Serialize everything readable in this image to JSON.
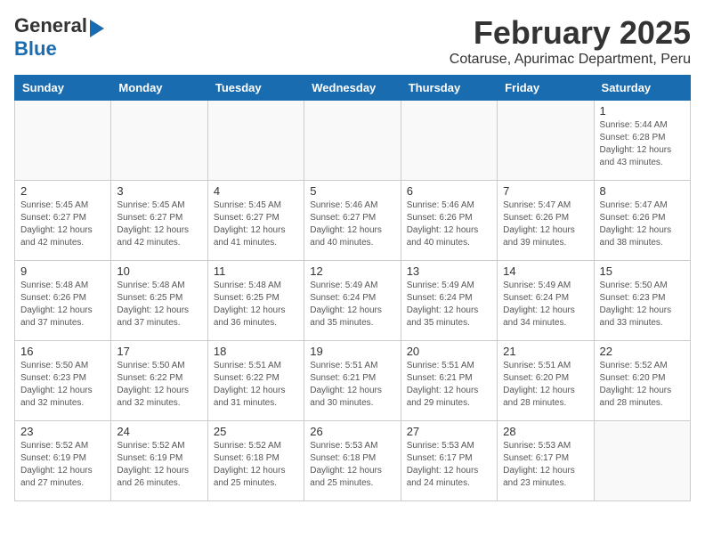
{
  "header": {
    "logo_general": "General",
    "logo_blue": "Blue",
    "title": "February 2025",
    "subtitle": "Cotaruse, Apurimac Department, Peru"
  },
  "days_of_week": [
    "Sunday",
    "Monday",
    "Tuesday",
    "Wednesday",
    "Thursday",
    "Friday",
    "Saturday"
  ],
  "weeks": [
    [
      {
        "day": null
      },
      {
        "day": null
      },
      {
        "day": null
      },
      {
        "day": null
      },
      {
        "day": null
      },
      {
        "day": null
      },
      {
        "day": "1",
        "sunrise": "5:44 AM",
        "sunset": "6:28 PM",
        "daylight": "12 hours and 43 minutes."
      }
    ],
    [
      {
        "day": "2",
        "sunrise": "5:45 AM",
        "sunset": "6:27 PM",
        "daylight": "12 hours and 42 minutes."
      },
      {
        "day": "3",
        "sunrise": "5:45 AM",
        "sunset": "6:27 PM",
        "daylight": "12 hours and 42 minutes."
      },
      {
        "day": "4",
        "sunrise": "5:45 AM",
        "sunset": "6:27 PM",
        "daylight": "12 hours and 41 minutes."
      },
      {
        "day": "5",
        "sunrise": "5:46 AM",
        "sunset": "6:27 PM",
        "daylight": "12 hours and 40 minutes."
      },
      {
        "day": "6",
        "sunrise": "5:46 AM",
        "sunset": "6:26 PM",
        "daylight": "12 hours and 40 minutes."
      },
      {
        "day": "7",
        "sunrise": "5:47 AM",
        "sunset": "6:26 PM",
        "daylight": "12 hours and 39 minutes."
      },
      {
        "day": "8",
        "sunrise": "5:47 AM",
        "sunset": "6:26 PM",
        "daylight": "12 hours and 38 minutes."
      }
    ],
    [
      {
        "day": "9",
        "sunrise": "5:48 AM",
        "sunset": "6:26 PM",
        "daylight": "12 hours and 37 minutes."
      },
      {
        "day": "10",
        "sunrise": "5:48 AM",
        "sunset": "6:25 PM",
        "daylight": "12 hours and 37 minutes."
      },
      {
        "day": "11",
        "sunrise": "5:48 AM",
        "sunset": "6:25 PM",
        "daylight": "12 hours and 36 minutes."
      },
      {
        "day": "12",
        "sunrise": "5:49 AM",
        "sunset": "6:24 PM",
        "daylight": "12 hours and 35 minutes."
      },
      {
        "day": "13",
        "sunrise": "5:49 AM",
        "sunset": "6:24 PM",
        "daylight": "12 hours and 35 minutes."
      },
      {
        "day": "14",
        "sunrise": "5:49 AM",
        "sunset": "6:24 PM",
        "daylight": "12 hours and 34 minutes."
      },
      {
        "day": "15",
        "sunrise": "5:50 AM",
        "sunset": "6:23 PM",
        "daylight": "12 hours and 33 minutes."
      }
    ],
    [
      {
        "day": "16",
        "sunrise": "5:50 AM",
        "sunset": "6:23 PM",
        "daylight": "12 hours and 32 minutes."
      },
      {
        "day": "17",
        "sunrise": "5:50 AM",
        "sunset": "6:22 PM",
        "daylight": "12 hours and 32 minutes."
      },
      {
        "day": "18",
        "sunrise": "5:51 AM",
        "sunset": "6:22 PM",
        "daylight": "12 hours and 31 minutes."
      },
      {
        "day": "19",
        "sunrise": "5:51 AM",
        "sunset": "6:21 PM",
        "daylight": "12 hours and 30 minutes."
      },
      {
        "day": "20",
        "sunrise": "5:51 AM",
        "sunset": "6:21 PM",
        "daylight": "12 hours and 29 minutes."
      },
      {
        "day": "21",
        "sunrise": "5:51 AM",
        "sunset": "6:20 PM",
        "daylight": "12 hours and 28 minutes."
      },
      {
        "day": "22",
        "sunrise": "5:52 AM",
        "sunset": "6:20 PM",
        "daylight": "12 hours and 28 minutes."
      }
    ],
    [
      {
        "day": "23",
        "sunrise": "5:52 AM",
        "sunset": "6:19 PM",
        "daylight": "12 hours and 27 minutes."
      },
      {
        "day": "24",
        "sunrise": "5:52 AM",
        "sunset": "6:19 PM",
        "daylight": "12 hours and 26 minutes."
      },
      {
        "day": "25",
        "sunrise": "5:52 AM",
        "sunset": "6:18 PM",
        "daylight": "12 hours and 25 minutes."
      },
      {
        "day": "26",
        "sunrise": "5:53 AM",
        "sunset": "6:18 PM",
        "daylight": "12 hours and 25 minutes."
      },
      {
        "day": "27",
        "sunrise": "5:53 AM",
        "sunset": "6:17 PM",
        "daylight": "12 hours and 24 minutes."
      },
      {
        "day": "28",
        "sunrise": "5:53 AM",
        "sunset": "6:17 PM",
        "daylight": "12 hours and 23 minutes."
      },
      {
        "day": null
      }
    ]
  ]
}
